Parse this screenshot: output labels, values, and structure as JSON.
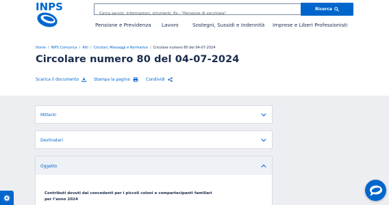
{
  "brand": {
    "logo_text": "INPS",
    "accent": "#0066cc"
  },
  "search": {
    "placeholder": "Cerca servizi, informazioni, strumenti. Es.: \"Pensione di vecchiaia\"",
    "value": "",
    "button_label": "Ricerca"
  },
  "mainnav": {
    "items": [
      {
        "label": "Pensione e Previdenza"
      },
      {
        "label": "Lavoro"
      },
      {
        "label": "Sostegni, Sussidi e Indennità"
      },
      {
        "label": "Imprese e Liberi Professionisti"
      }
    ]
  },
  "breadcrumb": {
    "items": [
      {
        "label": "Home"
      },
      {
        "label": "INPS Comunica"
      },
      {
        "label": "Atti"
      },
      {
        "label": "Circolari, Messaggi e Normativa"
      },
      {
        "label": "Circolare numero 80 del 04-07-2024"
      }
    ],
    "separator": "/"
  },
  "page": {
    "title": "Circolare numero 80 del 04-07-2024"
  },
  "actions": {
    "download": "Scarica il documento",
    "print": "Stampa la pagina",
    "share": "Condividi"
  },
  "accordion": {
    "sections": [
      {
        "label": "Mittenti",
        "open": false
      },
      {
        "label": "Destinatari",
        "open": false
      },
      {
        "label": "Oggetto",
        "open": true
      }
    ],
    "content": "Contributi dovuti dai concedenti per i piccoli coloni e compartecipanti familiari per l’anno 2024"
  },
  "icons": {
    "search": "search-icon",
    "download": "download-icon",
    "print": "printer-icon",
    "share": "share-icon",
    "chevron": "chevron-icon",
    "settings": "gear-icon",
    "chat": "chat-icon"
  }
}
